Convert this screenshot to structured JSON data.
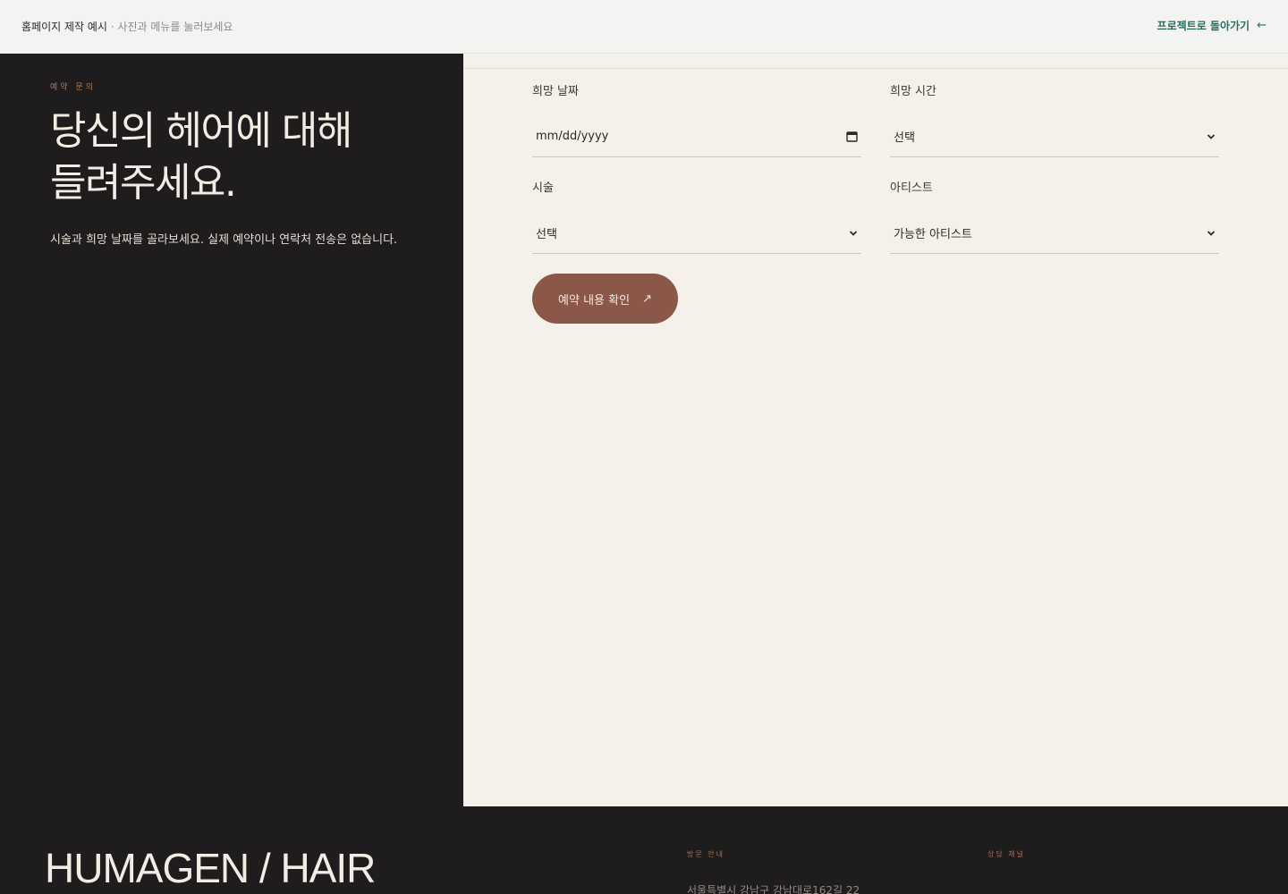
{
  "topbar": {
    "title": "홈페이지 제작 예시",
    "separator": " · ",
    "hint": "사진과 메뉴를 눌러보세요",
    "back_label": "프로젝트로 돌아가기",
    "back_icon": "arrow-left-icon"
  },
  "intro": {
    "eyebrow": "예약 문의",
    "headline_line1": "당신의 헤어에 대해",
    "headline_line2": "들려주세요.",
    "lead": "시술과 희망 날짜를 골라보세요. 실제 예약이나 연락처 전송은 없습니다."
  },
  "form": {
    "date": {
      "label": "희망 날짜",
      "placeholder": "mm/dd/yyyy",
      "icon": "calendar-icon"
    },
    "time": {
      "label": "희망 시간",
      "value": "선택"
    },
    "service": {
      "label": "시술",
      "value": "선택"
    },
    "artist": {
      "label": "아티스트",
      "value": "가능한 아티스트"
    },
    "submit_label": "예약 내용 확인",
    "submit_icon": "arrow-up-right-icon"
  },
  "footer": {
    "brand": "HUMAGEN / HAIR",
    "visit": {
      "caption": "방문 안내",
      "address": "서울특별시 강남구 강남대로162길 22"
    },
    "contact": {
      "caption": "상담 채널"
    }
  },
  "colors": {
    "dark_bg": "#1e1c1c",
    "cream_bg": "#f5f0ea",
    "accent_button": "#8b5749",
    "accent_teal": "#2f6b61",
    "eyebrow": "#b07a5e"
  }
}
